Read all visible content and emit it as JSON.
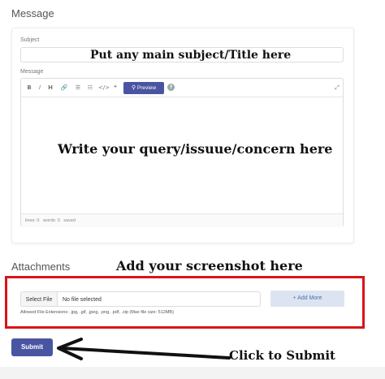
{
  "section": {
    "message_title": "Message",
    "attachments_title": "Attachments"
  },
  "form": {
    "subject_label": "Subject",
    "subject_annotation": "Put any main subject/Title here",
    "message_label": "Message",
    "message_annotation": "Write your query/issuue/concern here"
  },
  "toolbar": {
    "bold": "B",
    "italic": "I",
    "heading": "H",
    "link": "🔗",
    "unordered_list": "☰",
    "ordered_list": "☷",
    "code": "</>",
    "quote": "❝",
    "preview_label": "Preview",
    "help": "?",
    "fullscreen": "⤢"
  },
  "status": {
    "lines": "lines: 0",
    "words": "words: 0",
    "saved": "saved"
  },
  "attachments": {
    "annotation": "Add your screenshot here",
    "select_file_label": "Select File",
    "file_status": "No file selected",
    "add_more_label": "+ Add More",
    "allowed_info": "Allowed File Extensions: .jpg, .gif, .jpeg, .png, .pdf, .zip (Max file size: 512MB)"
  },
  "submit": {
    "label": "Submit",
    "annotation": "Click to Submit"
  },
  "colors": {
    "accent": "#4a55a2",
    "highlight_border": "#d9141b",
    "add_more_bg": "#dde4f1"
  }
}
